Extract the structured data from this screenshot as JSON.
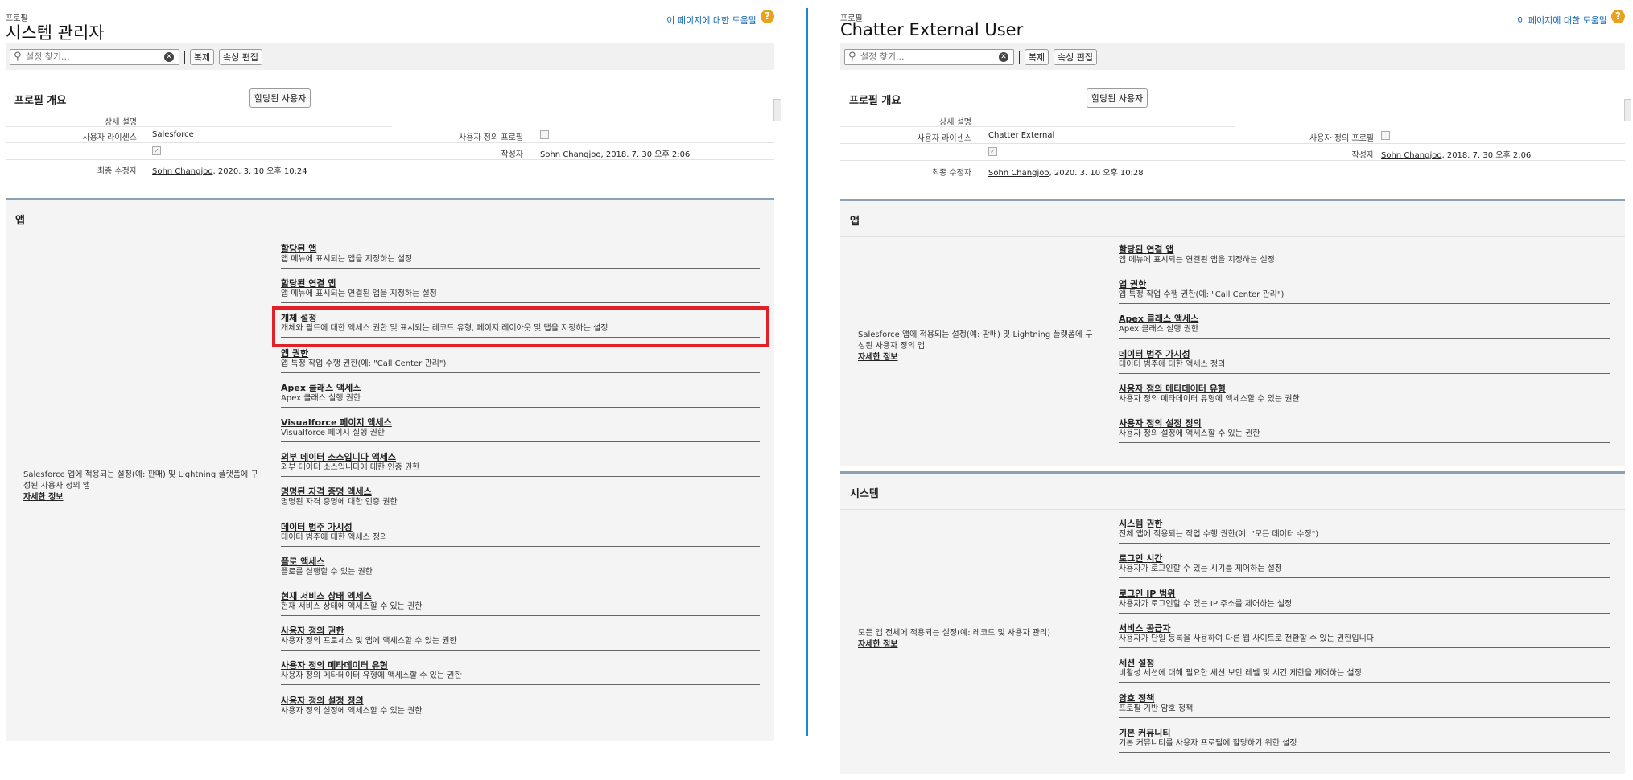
{
  "left": {
    "pretitle": "프로필",
    "title": "시스템 관리자",
    "help_link": "이 페이지에 대한 도움말",
    "help_icon": "?",
    "search_placeholder": "설정 찾기...",
    "copy_button": "복제",
    "edit_properties_button": "속성 편집",
    "overview_title": "프로필 개요",
    "assigned_users_button": "할당된 사용자",
    "detail_label": "상세 설명",
    "license_label": "사용자 라이센스",
    "license_value": "Salesforce",
    "custom_profile_label": "사용자 정의 프로필",
    "created_by_label": "작성자",
    "created_by_name": "Sohn Changjoo",
    "created_by_date": ", 2018. 7. 30 오후 2:06",
    "modified_by_label": "최종 수정자",
    "modified_by_name": "Sohn Changjoo",
    "modified_by_date": ", 2020. 3. 10 오후 10:24",
    "apps_title": "앱",
    "apps_desc": "Salesforce 앱에 적용되는 설정(예: 판매) 및 Lightning 플랫폼에 구성된 사용자 정의 앱",
    "apps_more": "자세한 정보",
    "perms": [
      {
        "title": "할당된 앱",
        "desc": "앱 메뉴에 표시되는 앱을 지정하는 설정"
      },
      {
        "title": "할당된 연결 앱",
        "desc": "앱 메뉴에 표시되는 연결된 앱을 지정하는 설정"
      },
      {
        "title": "개체 설정",
        "desc": "개체와 필드에 대한 액세스 권한 및 표시되는 레코드 유형, 페이지 레이아웃 및 탭을 지정하는 설정"
      },
      {
        "title": "앱 권한",
        "desc": "앱 특정 작업 수행 권한(예: \"Call Center 관리\")"
      },
      {
        "title": "Apex 클래스 액세스",
        "desc": "Apex 클래스 실행 권한"
      },
      {
        "title": "Visualforce 페이지 액세스",
        "desc": "Visualforce 페이지 실행 권한"
      },
      {
        "title": "외부 데이터 소스입니다 액세스",
        "desc": "외부 데이터 소스입니다에 대한 인증 권한"
      },
      {
        "title": "명명된 자격 증명 액세스",
        "desc": "명명된 자격 증명에 대한 인증 권한"
      },
      {
        "title": "데이터 범주 가시성",
        "desc": "데이터 범주에 대한 액세스 정의"
      },
      {
        "title": "플로 액세스",
        "desc": "플로를 실행할 수 있는 권한"
      },
      {
        "title": "현재 서비스 상태 액세스",
        "desc": "현재 서비스 상태에 액세스할 수 있는 권한"
      },
      {
        "title": "사용자 정의 권한",
        "desc": "사용자 정의 프로세스 및 앱에 액세스할 수 있는 권한"
      },
      {
        "title": "사용자 정의 메타데이터 유형",
        "desc": "사용자 정의 메타데이터 유형에 액세스할 수 있는 권한"
      },
      {
        "title": "사용자 정의 설정 정의",
        "desc": "사용자 정의 설정에 액세스할 수 있는 권한"
      }
    ]
  },
  "right": {
    "pretitle": "프로필",
    "title": "Chatter External User",
    "help_link": "이 페이지에 대한 도움말",
    "help_icon": "?",
    "search_placeholder": "설정 찾기...",
    "copy_button": "복제",
    "edit_properties_button": "속성 편집",
    "overview_title": "프로필 개요",
    "assigned_users_button": "할당된 사용자",
    "detail_label": "상세 설명",
    "license_label": "사용자 라이센스",
    "license_value": "Chatter External",
    "custom_profile_label": "사용자 정의 프로필",
    "created_by_label": "작성자",
    "created_by_name": "Sohn Changjoo",
    "created_by_date": ", 2018. 7. 30 오후 2:06",
    "modified_by_label": "최종 수정자",
    "modified_by_name": "Sohn Changjoo",
    "modified_by_date": ", 2020. 3. 10 오후 10:28",
    "apps_title": "앱",
    "apps_desc": "Salesforce 앱에 적용되는 설정(예: 판매) 및 Lightning 플랫폼에 구성된 사용자 정의 앱",
    "apps_more": "자세한 정보",
    "perms": [
      {
        "title": "할당된 연결 앱",
        "desc": "앱 메뉴에 표시되는 연결된 앱을 지정하는 설정"
      },
      {
        "title": "앱 권한",
        "desc": "앱 특정 작업 수행 권한(예: \"Call Center 관리\")"
      },
      {
        "title": "Apex 클래스 액세스",
        "desc": "Apex 클래스 실행 권한"
      },
      {
        "title": "데이터 범주 가시성",
        "desc": "데이터 범주에 대한 액세스 정의"
      },
      {
        "title": "사용자 정의 메타데이터 유형",
        "desc": "사용자 정의 메타데이터 유형에 액세스할 수 있는 권한"
      },
      {
        "title": "사용자 정의 설정 정의",
        "desc": "사용자 정의 설정에 액세스할 수 있는 권한"
      }
    ],
    "system_title": "시스템",
    "system_desc": "모든 앱 전체에 적용되는 설정(예: 레코드 및 사용자 관리)",
    "system_more": "자세한 정보",
    "system_perms": [
      {
        "title": "시스템 권한",
        "desc": "전체 앱에 적용되는 작업 수행 권한(예: \"모든 데이터 수정\")"
      },
      {
        "title": "로그인 시간",
        "desc": "사용자가 로그인할 수 있는 시기를 제어하는 설정"
      },
      {
        "title": "로그인 IP 범위",
        "desc": "사용자가 로그인할 수 있는 IP 주소를 제어하는 설정"
      },
      {
        "title": "서비스 공급자",
        "desc": "사용자가 단일 등록을 사용하여 다른 웹 사이트로 전환할 수 있는 권한입니다."
      },
      {
        "title": "세션 설정",
        "desc": "비활성 세션에 대해 필요한 세션 보안 레벨 및 시간 제한을 제어하는 설정"
      },
      {
        "title": "암호 정책",
        "desc": "프로필 기반 암호 정책"
      },
      {
        "title": "기본 커뮤니티",
        "desc": "기본 커뮤니티를 사용자 프로필에 할당하기 위한 설정"
      }
    ]
  },
  "colors": {
    "highlight": "#e22027",
    "divider": "#1589d1",
    "help_icon": "#e8a21d",
    "link": "#1468b3"
  }
}
